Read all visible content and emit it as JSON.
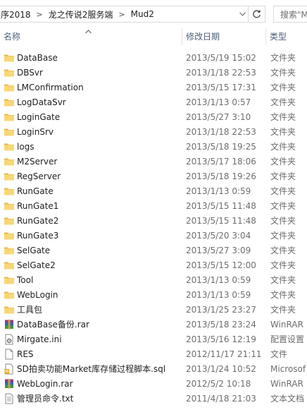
{
  "address_bar": {
    "crumbs": [
      "序2018",
      "龙之传说2服务端",
      "Mud2"
    ],
    "search_placeholder": "搜索\"M"
  },
  "columns": {
    "name": "名称",
    "date": "修改日期",
    "type": "类型"
  },
  "files": [
    {
      "name": "DataBase",
      "date": "2013/5/19 15:02",
      "type": "文件夹",
      "icon": "folder-icon"
    },
    {
      "name": "DBSvr",
      "date": "2013/1/18 22:53",
      "type": "文件夹",
      "icon": "folder-icon"
    },
    {
      "name": "LMConfirmation",
      "date": "2013/5/15 17:31",
      "type": "文件夹",
      "icon": "folder-icon"
    },
    {
      "name": "LogDataSvr",
      "date": "2013/1/13 0:57",
      "type": "文件夹",
      "icon": "folder-icon"
    },
    {
      "name": "LoginGate",
      "date": "2013/5/27 3:10",
      "type": "文件夹",
      "icon": "folder-icon"
    },
    {
      "name": "LoginSrv",
      "date": "2013/1/18 22:53",
      "type": "文件夹",
      "icon": "folder-icon"
    },
    {
      "name": "logs",
      "date": "2013/5/18 19:25",
      "type": "文件夹",
      "icon": "folder-icon"
    },
    {
      "name": "M2Server",
      "date": "2013/5/17 18:06",
      "type": "文件夹",
      "icon": "folder-icon"
    },
    {
      "name": "RegServer",
      "date": "2013/5/18 19:26",
      "type": "文件夹",
      "icon": "folder-icon"
    },
    {
      "name": "RunGate",
      "date": "2013/1/13 0:59",
      "type": "文件夹",
      "icon": "folder-icon"
    },
    {
      "name": "RunGate1",
      "date": "2013/5/15 11:48",
      "type": "文件夹",
      "icon": "folder-icon"
    },
    {
      "name": "RunGate2",
      "date": "2013/5/15 11:48",
      "type": "文件夹",
      "icon": "folder-icon"
    },
    {
      "name": "RunGate3",
      "date": "2013/5/20 3:04",
      "type": "文件夹",
      "icon": "folder-icon"
    },
    {
      "name": "SelGate",
      "date": "2013/5/27 3:09",
      "type": "文件夹",
      "icon": "folder-icon"
    },
    {
      "name": "SelGate2",
      "date": "2013/5/15 12:00",
      "type": "文件夹",
      "icon": "folder-icon"
    },
    {
      "name": "Tool",
      "date": "2013/1/13 0:59",
      "type": "文件夹",
      "icon": "folder-icon"
    },
    {
      "name": "WebLogin",
      "date": "2013/1/13 0:59",
      "type": "文件夹",
      "icon": "folder-icon"
    },
    {
      "name": "工具包",
      "date": "2013/1/25 23:27",
      "type": "文件夹",
      "icon": "folder-icon"
    },
    {
      "name": "DataBase备份.rar",
      "date": "2013/5/18 23:24",
      "type": "WinRAR",
      "icon": "winrar-icon"
    },
    {
      "name": "Mirgate.ini",
      "date": "2013/5/16 12:19",
      "type": "配置设置",
      "icon": "ini-icon"
    },
    {
      "name": "RES",
      "date": "2012/11/17 21:11",
      "type": "文件",
      "icon": "file-icon"
    },
    {
      "name": "SD拍卖功能Market库存储过程脚本.sql",
      "date": "2013/1/24 10:52",
      "type": "Microsof",
      "icon": "sql-icon"
    },
    {
      "name": "WebLogin.rar",
      "date": "2012/5/2 10:18",
      "type": "WinRAR",
      "icon": "winrar-icon"
    },
    {
      "name": "管理员命令.txt",
      "date": "2011/4/18 21:03",
      "type": "文本文档",
      "icon": "txt-icon"
    }
  ]
}
